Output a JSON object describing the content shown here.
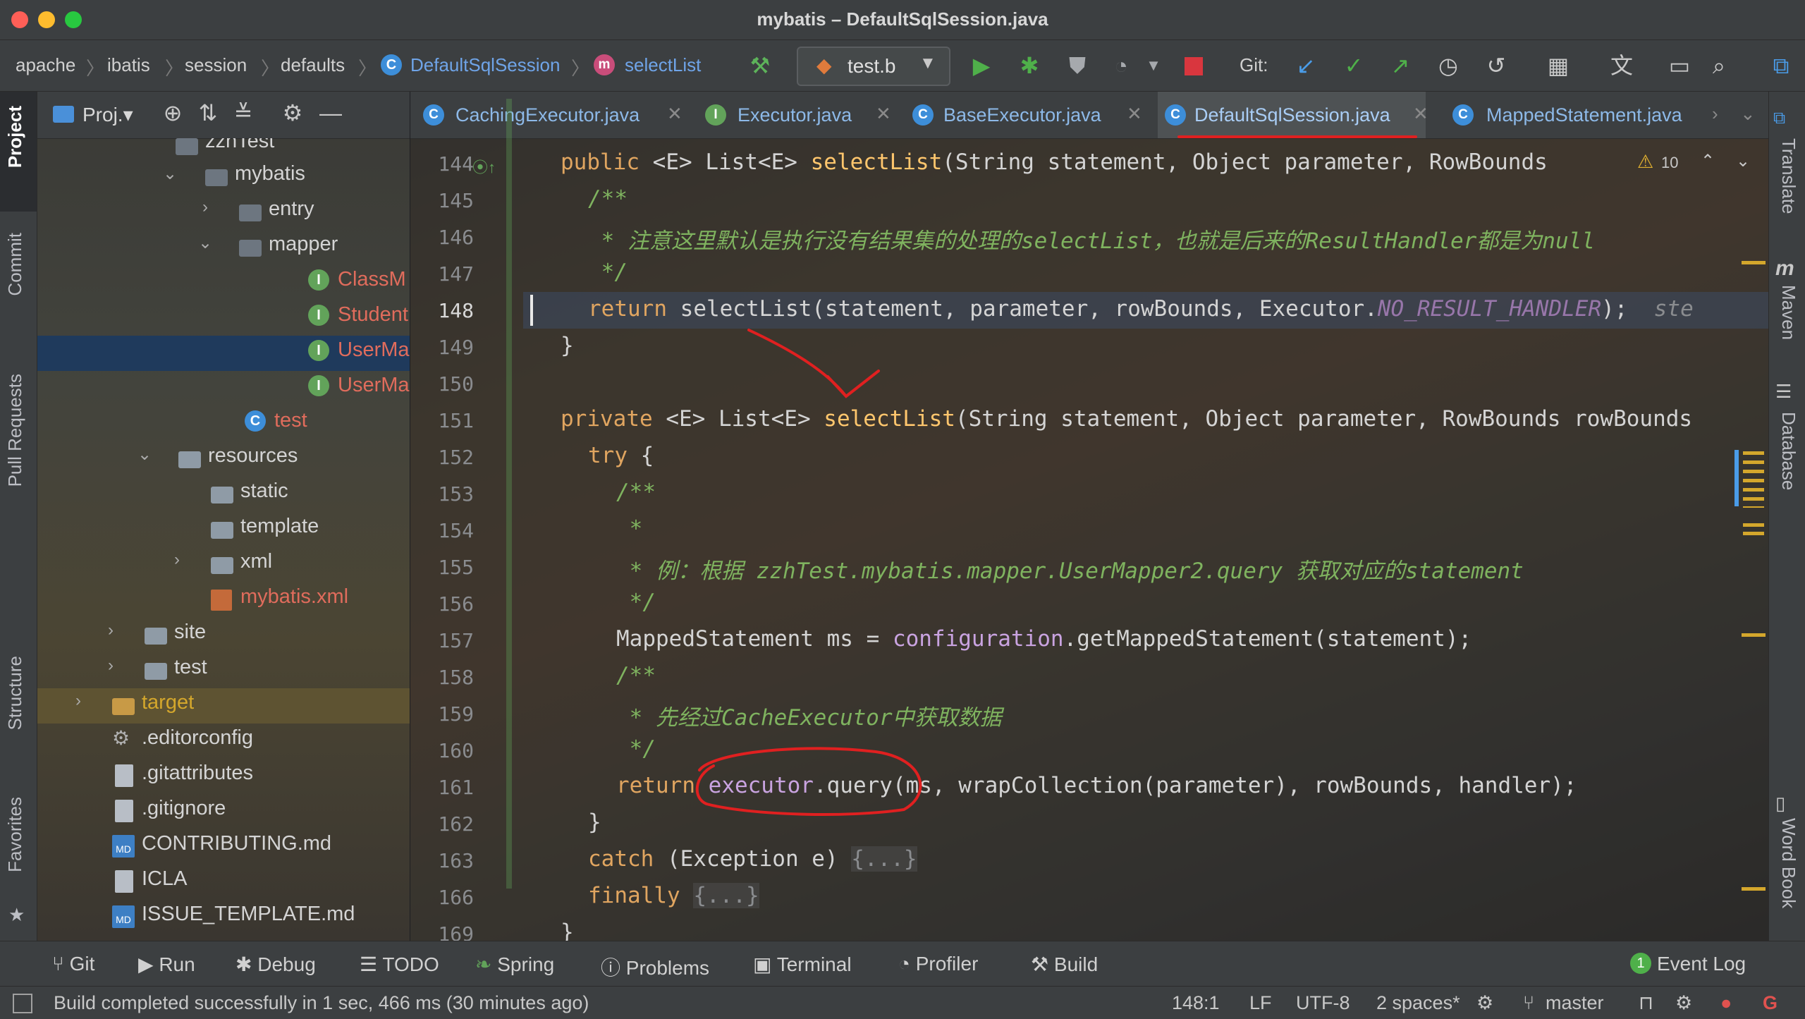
{
  "window": {
    "title": "mybatis – DefaultSqlSession.java"
  },
  "breadcrumb": [
    "apache",
    "ibatis",
    "session",
    "defaults",
    "DefaultSqlSession",
    "selectList"
  ],
  "run_config": "test.b",
  "git_label": "Git:",
  "left_stripe": {
    "project": "Project",
    "commit": "Commit",
    "pull_requests": "Pull Requests",
    "structure": "Structure",
    "favorites": "Favorites"
  },
  "project_panel": {
    "title": "Proj.▾",
    "items": [
      {
        "label": "zzhTest"
      },
      {
        "label": "mybatis"
      },
      {
        "label": "entry"
      },
      {
        "label": "mapper"
      },
      {
        "label": "ClassM"
      },
      {
        "label": "Student"
      },
      {
        "label": "UserMa"
      },
      {
        "label": "UserMa"
      },
      {
        "label": "test"
      },
      {
        "label": "resources"
      },
      {
        "label": "static"
      },
      {
        "label": "template"
      },
      {
        "label": "xml"
      },
      {
        "label": "mybatis.xml"
      },
      {
        "label": "site"
      },
      {
        "label": "test"
      },
      {
        "label": "target"
      },
      {
        "label": ".editorconfig"
      },
      {
        "label": ".gitattributes"
      },
      {
        "label": ".gitignore"
      },
      {
        "label": "CONTRIBUTING.md"
      },
      {
        "label": "ICLA"
      },
      {
        "label": "ISSUE_TEMPLATE.md"
      }
    ]
  },
  "tabs": [
    "CachingExecutor.java",
    "Executor.java",
    "BaseExecutor.java",
    "DefaultSqlSession.java",
    "MappedStatement.java"
  ],
  "active_tab": "DefaultSqlSession.java",
  "editor": {
    "line_numbers": [
      "144",
      "145",
      "146",
      "147",
      "148",
      "149",
      "150",
      "151",
      "152",
      "153",
      "154",
      "155",
      "156",
      "157",
      "158",
      "159",
      "160",
      "161",
      "162",
      "163",
      "166",
      "169"
    ],
    "warning_count": "10",
    "lines": {
      "l144": {
        "a": "public ",
        "b": "<E> ",
        "c": "List<E> ",
        "d": "selectList",
        "e": "(String statement, Object parameter, RowBounds"
      },
      "l145": "/**",
      "l146": {
        "a": " * 注意这里默认是执行没有结果集的处理的",
        "b": "selectList",
        "c": "，也就是后来的",
        "d": "ResultHandler",
        "e": "都是为",
        "f": "null"
      },
      "l147": " */",
      "l148": {
        "a": "return ",
        "b": "selectList(statement, parameter, rowBounds, Executor.",
        "c": "NO_RESULT_HANDLER",
        "d": ");",
        "e": "  ste"
      },
      "l149": "}",
      "l151": {
        "a": "private ",
        "b": "<E> ",
        "c": "List<E> ",
        "d": "selectList",
        "e": "(String statement, Object parameter, RowBounds rowBounds"
      },
      "l152": {
        "a": "try ",
        "b": "{"
      },
      "l153": "/**",
      "l154": " *",
      "l155": {
        "a": " * 例：根据 ",
        "b": "zzhTest.mybatis.mapper.UserMapper2.query",
        "c": " 获取对应的",
        "d": "statement"
      },
      "l156": " */",
      "l157": {
        "a": "MappedStatement ms = ",
        "b": "configuration",
        "c": ".getMappedStatement(statement);"
      },
      "l158": "/**",
      "l159": {
        "a": " * 先经过",
        "b": "CacheExecutor",
        "c": "中获取数据"
      },
      "l160": " */",
      "l161": {
        "a": "return ",
        "b": "executor",
        "c": ".query(ms, wrapCollection(parameter), rowBounds, handler);"
      },
      "l162": "}",
      "l163": {
        "a": "catch ",
        "b": "(Exception e) ",
        "c": "{...}"
      },
      "l166": {
        "a": "finally ",
        "b": "{...}"
      },
      "l169": "}"
    }
  },
  "right_stripe": {
    "translate": "Translate",
    "maven": "Maven",
    "database": "Database",
    "word_book": "Word Book"
  },
  "bottom_tools": [
    "Git",
    "Run",
    "Debug",
    "TODO",
    "Spring",
    "Problems",
    "Terminal",
    "Profiler",
    "Build"
  ],
  "event_log": {
    "count": "1",
    "label": "Event Log"
  },
  "status": {
    "message": "Build completed successfully in 1 sec, 466 ms (30 minutes ago)",
    "position": "148:1",
    "line_sep": "LF",
    "encoding": "UTF-8",
    "indent": "2 spaces*",
    "branch": "master"
  },
  "colors": {
    "keyword": "#e0a560",
    "method": "#ffc66d",
    "comment": "#7fb35f",
    "field": "#c9a3e0",
    "annotation_red": "#e02020"
  }
}
